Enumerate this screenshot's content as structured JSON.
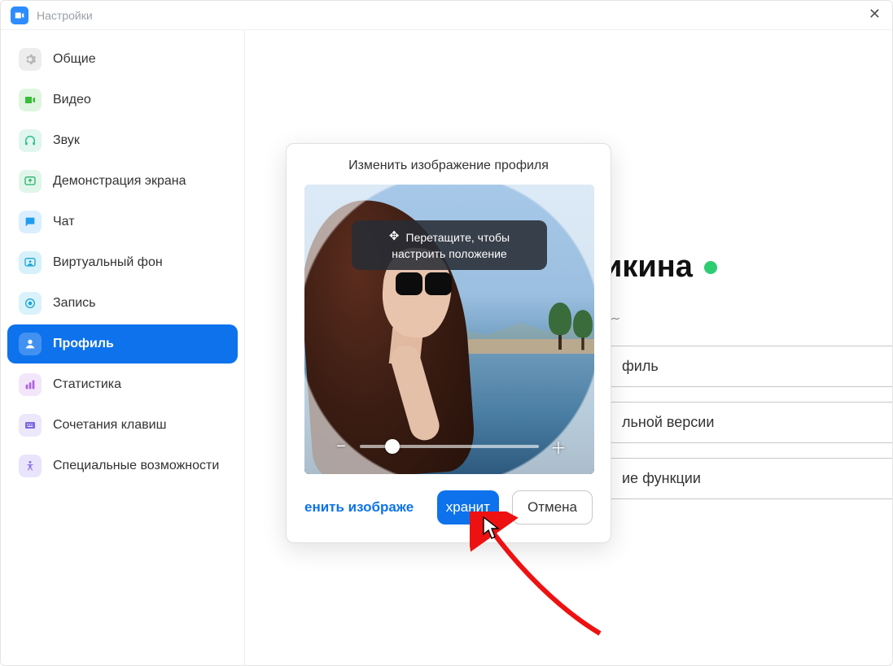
{
  "window": {
    "title": "Настройки"
  },
  "sidebar": {
    "items": [
      {
        "label": "Общие",
        "icon": "gear",
        "bg": "#ededed",
        "fg": "#b7b7b7"
      },
      {
        "label": "Видео",
        "icon": "video",
        "bg": "#dff5df",
        "fg": "#3bbb3b"
      },
      {
        "label": "Звук",
        "icon": "headphones",
        "bg": "#e1f6ee",
        "fg": "#28c28f"
      },
      {
        "label": "Демонстрация экрана",
        "icon": "share",
        "bg": "#e1f6ea",
        "fg": "#27b36a"
      },
      {
        "label": "Чат",
        "icon": "chat",
        "bg": "#dbeeff",
        "fg": "#1f9cef"
      },
      {
        "label": "Виртуальный фон",
        "icon": "vbg",
        "bg": "#d7f1fb",
        "fg": "#1ea6d6"
      },
      {
        "label": "Запись",
        "icon": "record",
        "bg": "#d9f2fb",
        "fg": "#1ea6d6"
      },
      {
        "label": "Профиль",
        "icon": "profile",
        "bg": "#ffffff",
        "fg": "#ffffff",
        "active": true
      },
      {
        "label": "Статистика",
        "icon": "stats",
        "bg": "#f3e6fb",
        "fg": "#b05fe0"
      },
      {
        "label": "Сочетания клавиш",
        "icon": "keyboard",
        "bg": "#ece7fb",
        "fg": "#7a66e0"
      },
      {
        "label": "Специальные возможности",
        "icon": "accessibility",
        "bg": "#e9e4fb",
        "fg": "#8a6ee8"
      }
    ]
  },
  "profile": {
    "name_partial": "икина",
    "status": "online",
    "hidden_placeholder": "﹏",
    "buttons": [
      {
        "label_partial": "филь"
      },
      {
        "label_partial": "льной версии"
      },
      {
        "label_partial": "ие функции"
      }
    ]
  },
  "modal": {
    "title": "Изменить изображение профиля",
    "drag_tip_line1": "Перетащите, чтобы",
    "drag_tip_line2": "настроить положение",
    "change_image_link_partial": "енить изображе",
    "save_button_partial": "хранит",
    "cancel_button": "Отмена",
    "zoom": {
      "min_symbol": "−",
      "max_symbol": "＋",
      "position_pct": 18
    }
  }
}
